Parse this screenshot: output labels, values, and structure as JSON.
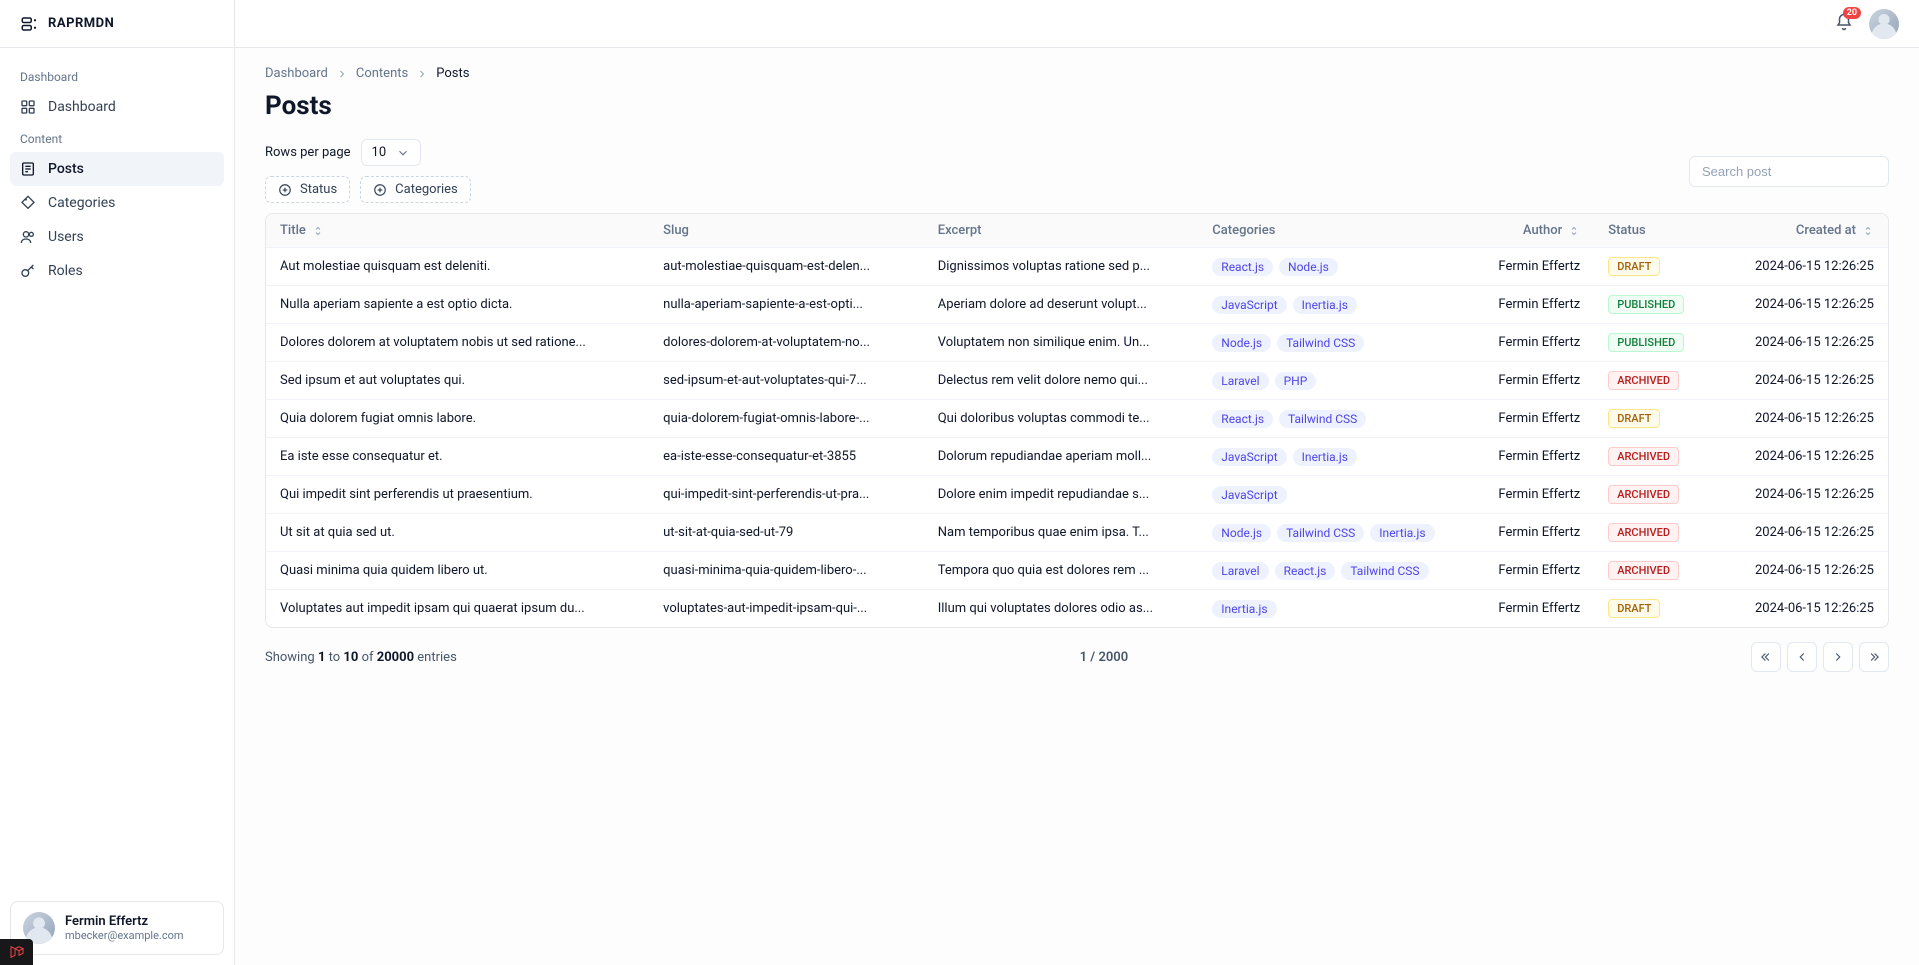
{
  "brand": "RAPRMDN",
  "notifications": {
    "count": "20"
  },
  "sidebar": {
    "sections": [
      {
        "label": "Dashboard",
        "items": [
          {
            "label": "Dashboard",
            "name": "dashboard"
          }
        ]
      },
      {
        "label": "Content",
        "items": [
          {
            "label": "Posts",
            "name": "posts",
            "active": true
          },
          {
            "label": "Categories",
            "name": "categories"
          },
          {
            "label": "Users",
            "name": "users"
          },
          {
            "label": "Roles",
            "name": "roles"
          }
        ]
      }
    ]
  },
  "user": {
    "name": "Fermin Effertz",
    "email": "mbecker@example.com"
  },
  "breadcrumb": [
    "Dashboard",
    "Contents",
    "Posts"
  ],
  "page_title": "Posts",
  "rows_label": "Rows per page",
  "rows_value": "10",
  "filters": {
    "status": "Status",
    "categories": "Categories"
  },
  "search_placeholder": "Search post",
  "columns": {
    "title": "Title",
    "slug": "Slug",
    "excerpt": "Excerpt",
    "categories": "Categories",
    "author": "Author",
    "status": "Status",
    "created": "Created at"
  },
  "status_labels": {
    "DRAFT": "DRAFT",
    "PUBLISHED": "PUBLISHED",
    "ARCHIVED": "ARCHIVED"
  },
  "rows": [
    {
      "title": "Aut molestiae quisquam est deleniti.",
      "slug": "aut-molestiae-quisquam-est-delen...",
      "excerpt": "Dignissimos voluptas ratione sed p...",
      "categories": [
        "React.js",
        "Node.js"
      ],
      "author": "Fermin Effertz",
      "status": "DRAFT",
      "created": "2024-06-15 12:26:25"
    },
    {
      "title": "Nulla aperiam sapiente a est optio dicta.",
      "slug": "nulla-aperiam-sapiente-a-est-opti...",
      "excerpt": "Aperiam dolore ad deserunt volupt...",
      "categories": [
        "JavaScript",
        "Inertia.js"
      ],
      "author": "Fermin Effertz",
      "status": "PUBLISHED",
      "created": "2024-06-15 12:26:25"
    },
    {
      "title": "Dolores dolorem at voluptatem nobis ut sed ratione...",
      "slug": "dolores-dolorem-at-voluptatem-no...",
      "excerpt": "Voluptatem non similique enim. Un...",
      "categories": [
        "Node.js",
        "Tailwind CSS"
      ],
      "author": "Fermin Effertz",
      "status": "PUBLISHED",
      "created": "2024-06-15 12:26:25"
    },
    {
      "title": "Sed ipsum et aut voluptates qui.",
      "slug": "sed-ipsum-et-aut-voluptates-qui-7...",
      "excerpt": "Delectus rem velit dolore nemo qui...",
      "categories": [
        "Laravel",
        "PHP"
      ],
      "author": "Fermin Effertz",
      "status": "ARCHIVED",
      "created": "2024-06-15 12:26:25"
    },
    {
      "title": "Quia dolorem fugiat omnis labore.",
      "slug": "quia-dolorem-fugiat-omnis-labore-...",
      "excerpt": "Qui doloribus voluptas commodi te...",
      "categories": [
        "React.js",
        "Tailwind CSS"
      ],
      "author": "Fermin Effertz",
      "status": "DRAFT",
      "created": "2024-06-15 12:26:25"
    },
    {
      "title": "Ea iste esse consequatur et.",
      "slug": "ea-iste-esse-consequatur-et-3855",
      "excerpt": "Dolorum repudiandae aperiam moll...",
      "categories": [
        "JavaScript",
        "Inertia.js"
      ],
      "author": "Fermin Effertz",
      "status": "ARCHIVED",
      "created": "2024-06-15 12:26:25"
    },
    {
      "title": "Qui impedit sint perferendis ut praesentium.",
      "slug": "qui-impedit-sint-perferendis-ut-pra...",
      "excerpt": "Dolore enim impedit repudiandae s...",
      "categories": [
        "JavaScript"
      ],
      "author": "Fermin Effertz",
      "status": "ARCHIVED",
      "created": "2024-06-15 12:26:25"
    },
    {
      "title": "Ut sit at quia sed ut.",
      "slug": "ut-sit-at-quia-sed-ut-79",
      "excerpt": "Nam temporibus quae enim ipsa. T...",
      "categories": [
        "Node.js",
        "Tailwind CSS",
        "Inertia.js"
      ],
      "author": "Fermin Effertz",
      "status": "ARCHIVED",
      "created": "2024-06-15 12:26:25"
    },
    {
      "title": "Quasi minima quia quidem libero ut.",
      "slug": "quasi-minima-quia-quidem-libero-...",
      "excerpt": "Tempora quo quia est dolores rem ...",
      "categories": [
        "Laravel",
        "React.js",
        "Tailwind CSS"
      ],
      "author": "Fermin Effertz",
      "status": "ARCHIVED",
      "created": "2024-06-15 12:26:25"
    },
    {
      "title": "Voluptates aut impedit ipsam qui quaerat ipsum du...",
      "slug": "voluptates-aut-impedit-ipsam-qui-...",
      "excerpt": "Illum qui voluptates dolores odio as...",
      "categories": [
        "Inertia.js"
      ],
      "author": "Fermin Effertz",
      "status": "DRAFT",
      "created": "2024-06-15 12:26:25"
    }
  ],
  "footer": {
    "showing_prefix": "Showing",
    "to": "to",
    "of": "of",
    "entries": "entries",
    "from": "1",
    "to_n": "10",
    "total": "20000",
    "page_current": "1",
    "page_total": "2000"
  }
}
